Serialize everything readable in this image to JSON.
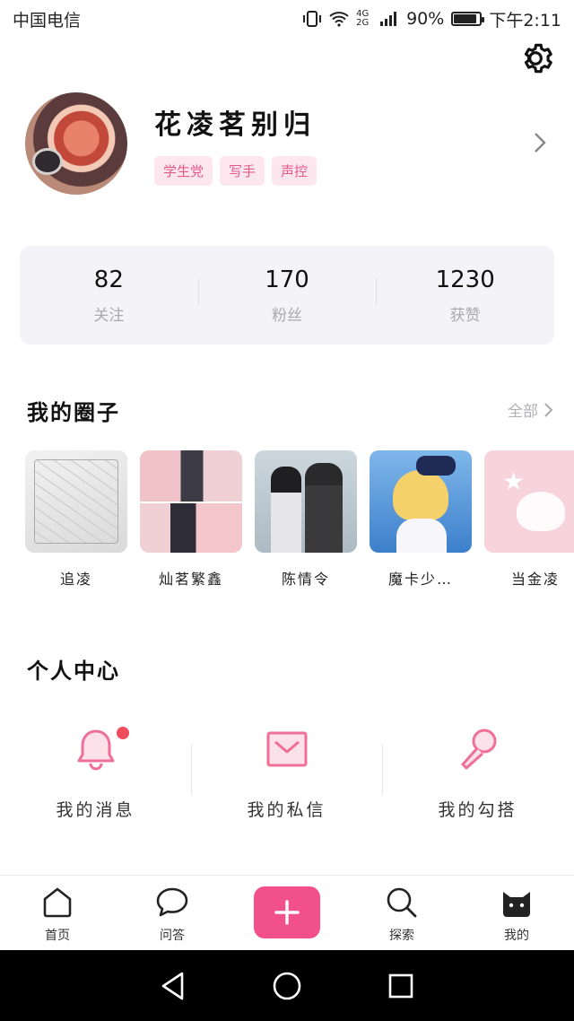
{
  "status_bar": {
    "carrier": "中国电信",
    "network": "4G 2G",
    "battery": "90%",
    "battery_level": 0.9,
    "time": "下午2:11"
  },
  "profile": {
    "username": "花凌茗别归",
    "tags": [
      "学生党",
      "写手",
      "声控"
    ]
  },
  "stats": [
    {
      "value": "82",
      "label": "关注"
    },
    {
      "value": "170",
      "label": "粉丝"
    },
    {
      "value": "1230",
      "label": "获赞"
    }
  ],
  "circles_section": {
    "title": "我的圈子",
    "view_all": "全部"
  },
  "circles": [
    {
      "name": "追凌"
    },
    {
      "name": "灿茗繁鑫"
    },
    {
      "name": "陈情令"
    },
    {
      "name": "魔卡少…"
    },
    {
      "name": "当金凌"
    }
  ],
  "personal_center": {
    "title": "个人中心",
    "items": [
      {
        "label": "我的消息",
        "icon": "bell-icon",
        "has_notification": true
      },
      {
        "label": "我的私信",
        "icon": "envelope-icon"
      },
      {
        "label": "我的勾搭",
        "icon": "microphone-icon"
      }
    ]
  },
  "tab_bar": [
    {
      "label": "首页",
      "icon": "home-icon"
    },
    {
      "label": "问答",
      "icon": "chat-bubble-icon"
    },
    {
      "label": "",
      "icon": "plus-icon"
    },
    {
      "label": "探索",
      "icon": "search-icon"
    },
    {
      "label": "我的",
      "icon": "cat-face-icon"
    }
  ],
  "colors": {
    "accent": "#f2508a",
    "tag_bg": "#fde6ee",
    "tag_text": "#e25a8a",
    "stats_bg": "#f4f4f8",
    "notification_dot": "#ef4d5e"
  }
}
